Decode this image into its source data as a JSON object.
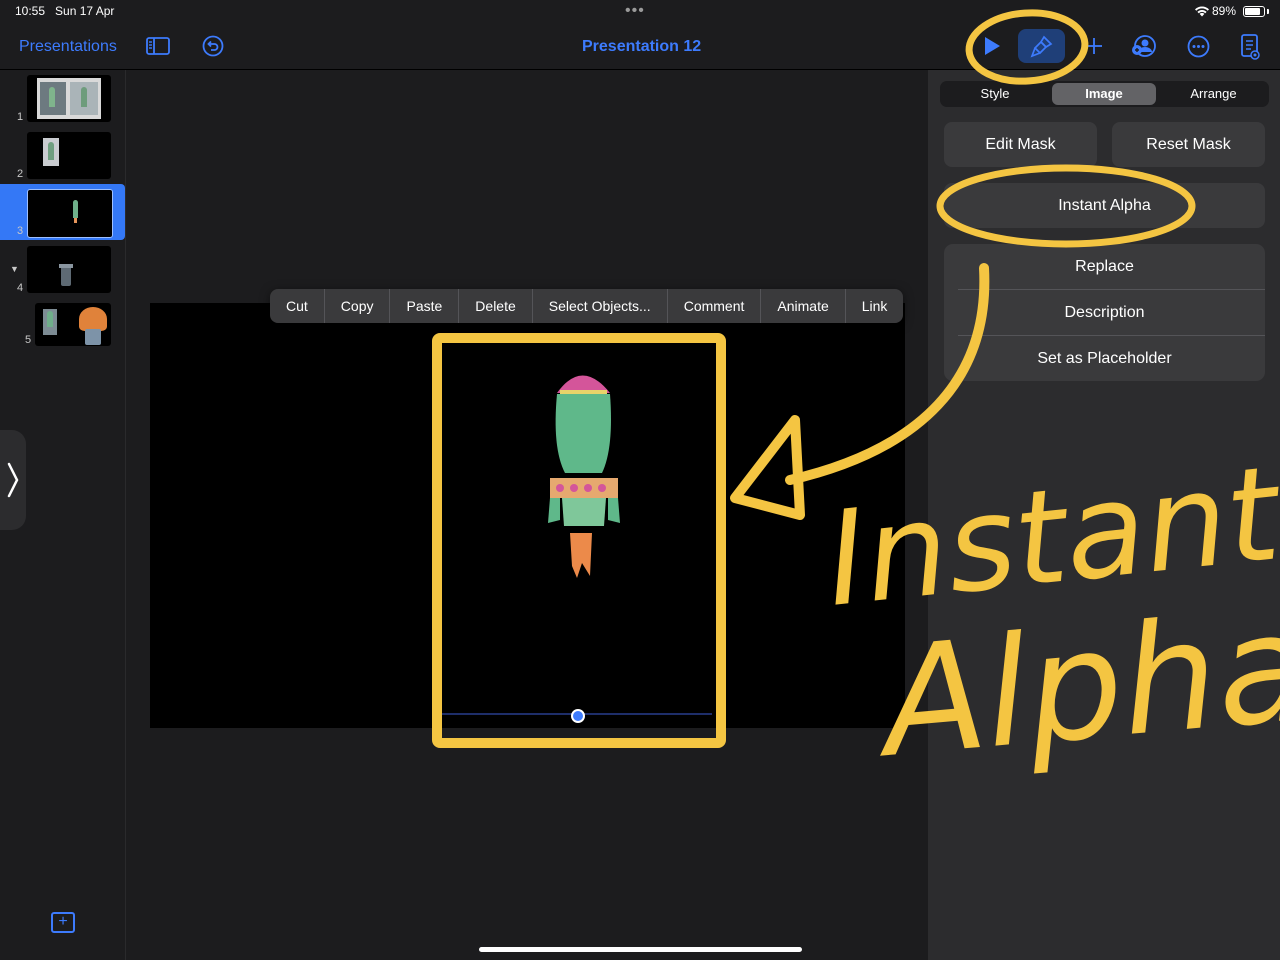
{
  "status_bar": {
    "time": "10:55",
    "date": "Sun 17 Apr",
    "battery": "89%",
    "battery_level": 0.89
  },
  "toolbar": {
    "back_label": "Presentations",
    "title": "Presentation 12",
    "icons": [
      "sidebar-icon",
      "undo-icon",
      "play-icon",
      "paintbrush-icon",
      "plus-icon",
      "collaborate-icon",
      "more-icon",
      "document-icon"
    ]
  },
  "navigator": {
    "slides": [
      {
        "number": "1"
      },
      {
        "number": "2"
      },
      {
        "number": "3",
        "selected": true
      },
      {
        "number": "4",
        "collapsed": true
      },
      {
        "number": "5"
      }
    ]
  },
  "context_menu": {
    "items": [
      "Cut",
      "Copy",
      "Paste",
      "Delete",
      "Select Objects...",
      "Comment",
      "Animate",
      "Link"
    ]
  },
  "inspector": {
    "tabs": [
      "Style",
      "Image",
      "Arrange"
    ],
    "selected_tab": "Image",
    "edit_mask": "Edit Mask",
    "reset_mask": "Reset Mask",
    "instant_alpha": "Instant Alpha",
    "list_items": [
      "Replace",
      "Description",
      "Set as Placeholder"
    ]
  },
  "annotation": {
    "handwritten_line1": "Instant",
    "handwritten_line2": "Alpha"
  },
  "colors": {
    "accent": "#3d7bfd",
    "annotation_yellow": "#f4c542",
    "background": "#1c1c1e",
    "inspector": "#2c2c2e"
  }
}
